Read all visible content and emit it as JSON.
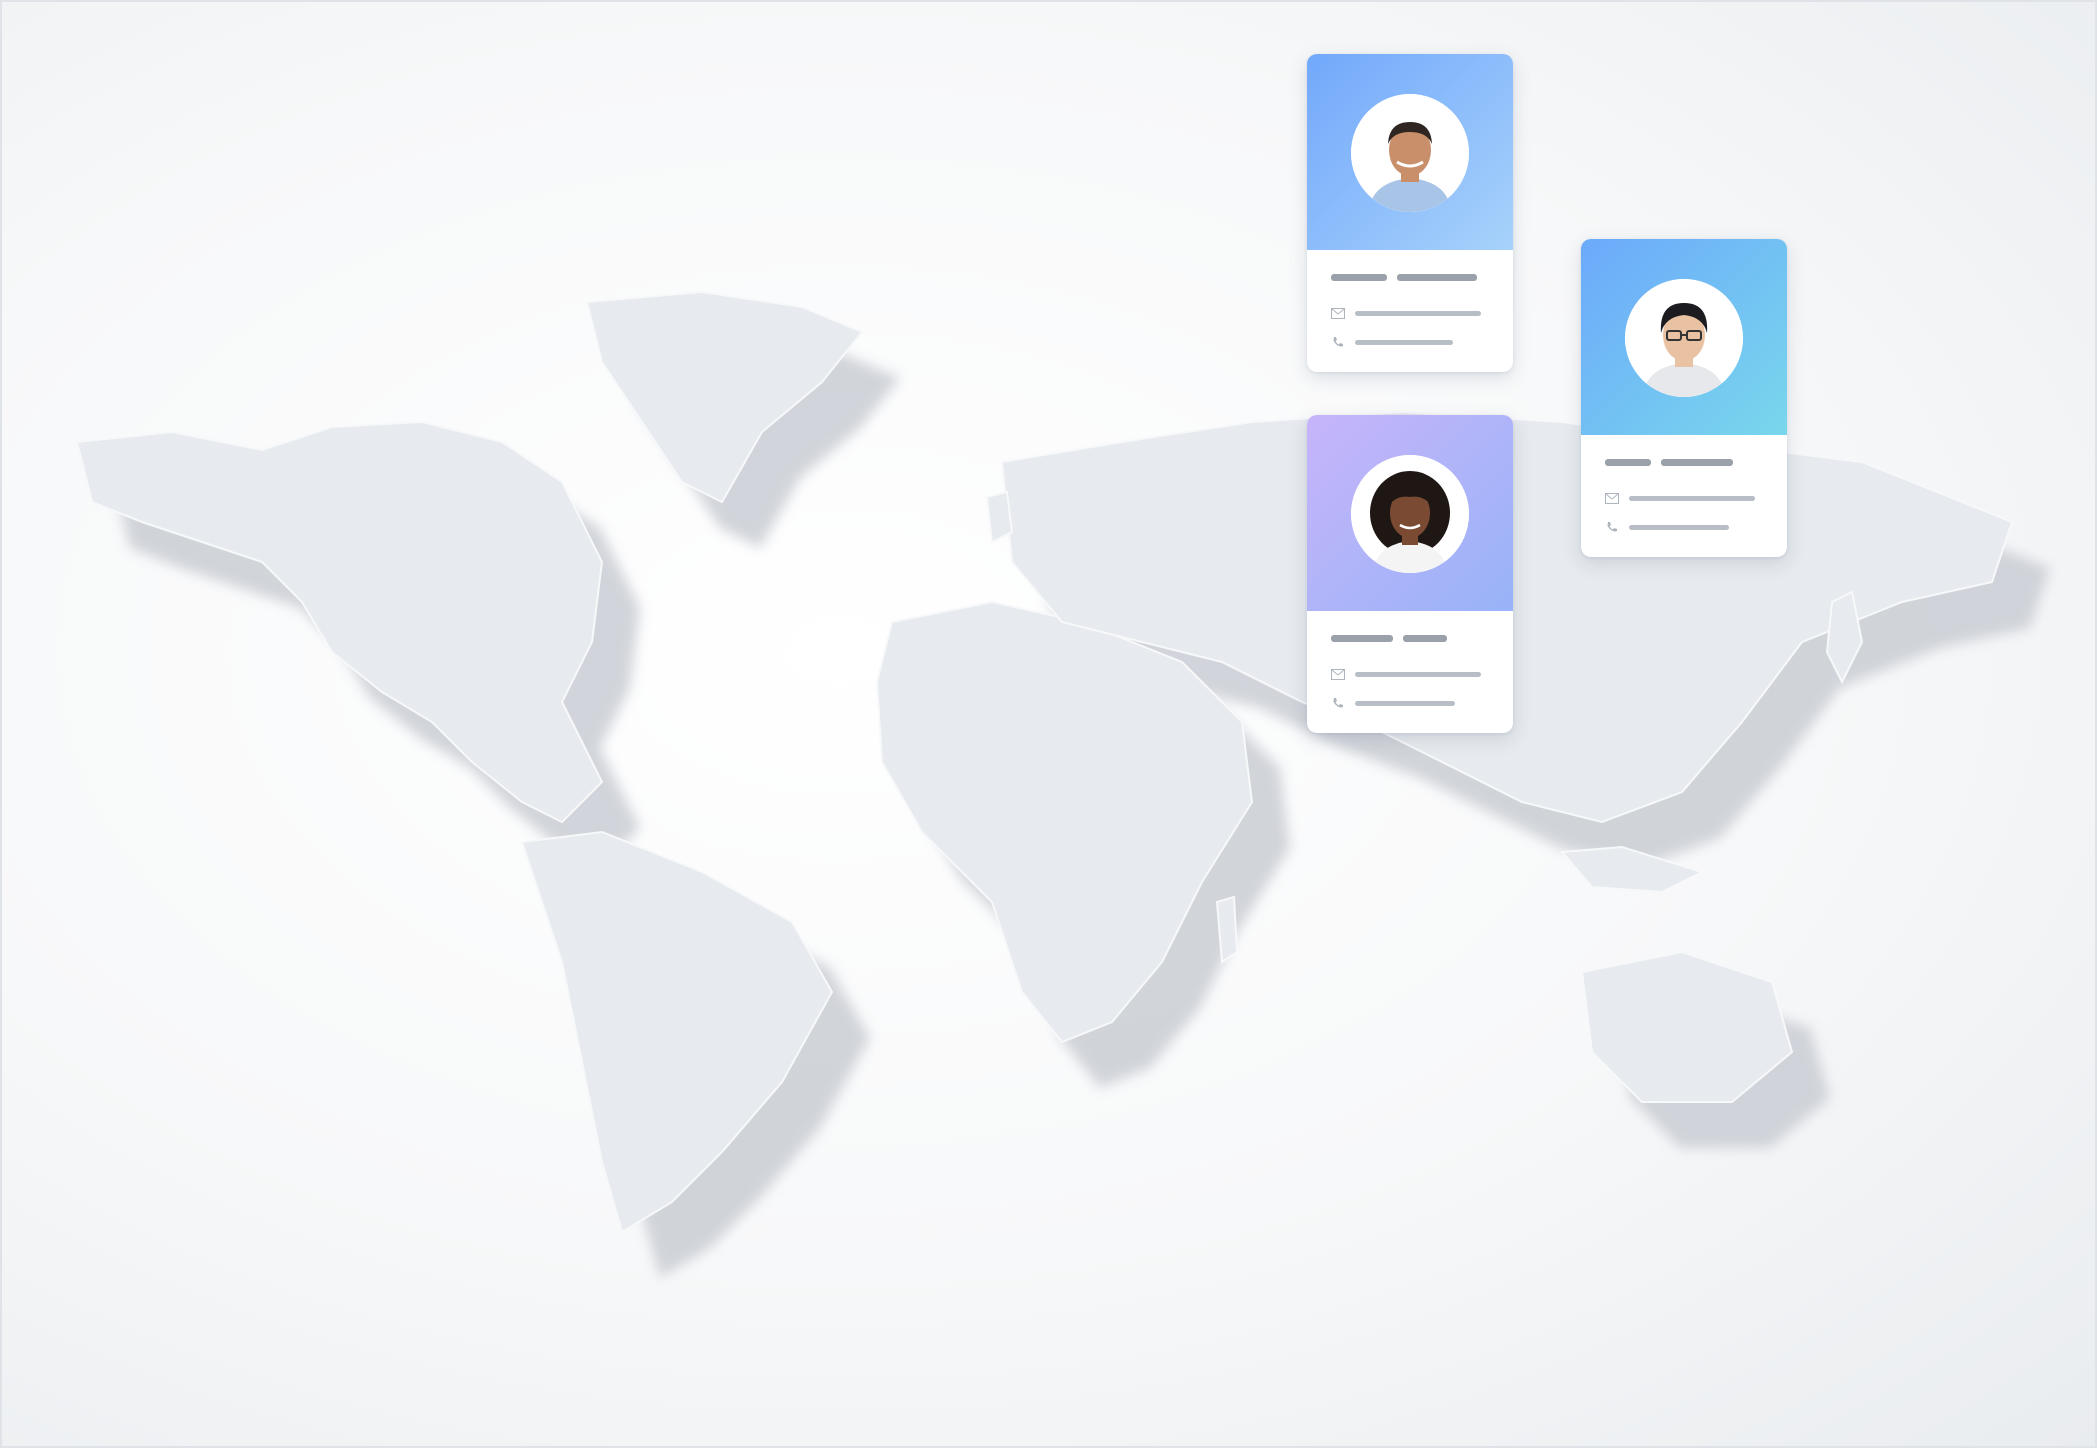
{
  "map": {
    "land_color": "#e6e9ed",
    "shadow_color": "#c9cdd3"
  },
  "cards": [
    {
      "id": "card-1",
      "avatar_icon": "man-portrait",
      "gradient_from": "#72a8fb",
      "gradient_to": "#a7d2fb",
      "skin": "#c98f6a",
      "hair": "#2f2622",
      "shirt": "#a8c4e6"
    },
    {
      "id": "card-2",
      "avatar_icon": "young-man-portrait",
      "gradient_from": "#6ca9fb",
      "gradient_to": "#78d7ec",
      "skin": "#e8c2a2",
      "hair": "#1c1c20",
      "shirt": "#e6e8eb"
    },
    {
      "id": "card-3",
      "avatar_icon": "woman-portrait",
      "gradient_from": "#c7b4fa",
      "gradient_to": "#98b3f8",
      "skin": "#7a4a33",
      "hair": "#1f1714",
      "shirt": "#f4f4f4"
    }
  ]
}
